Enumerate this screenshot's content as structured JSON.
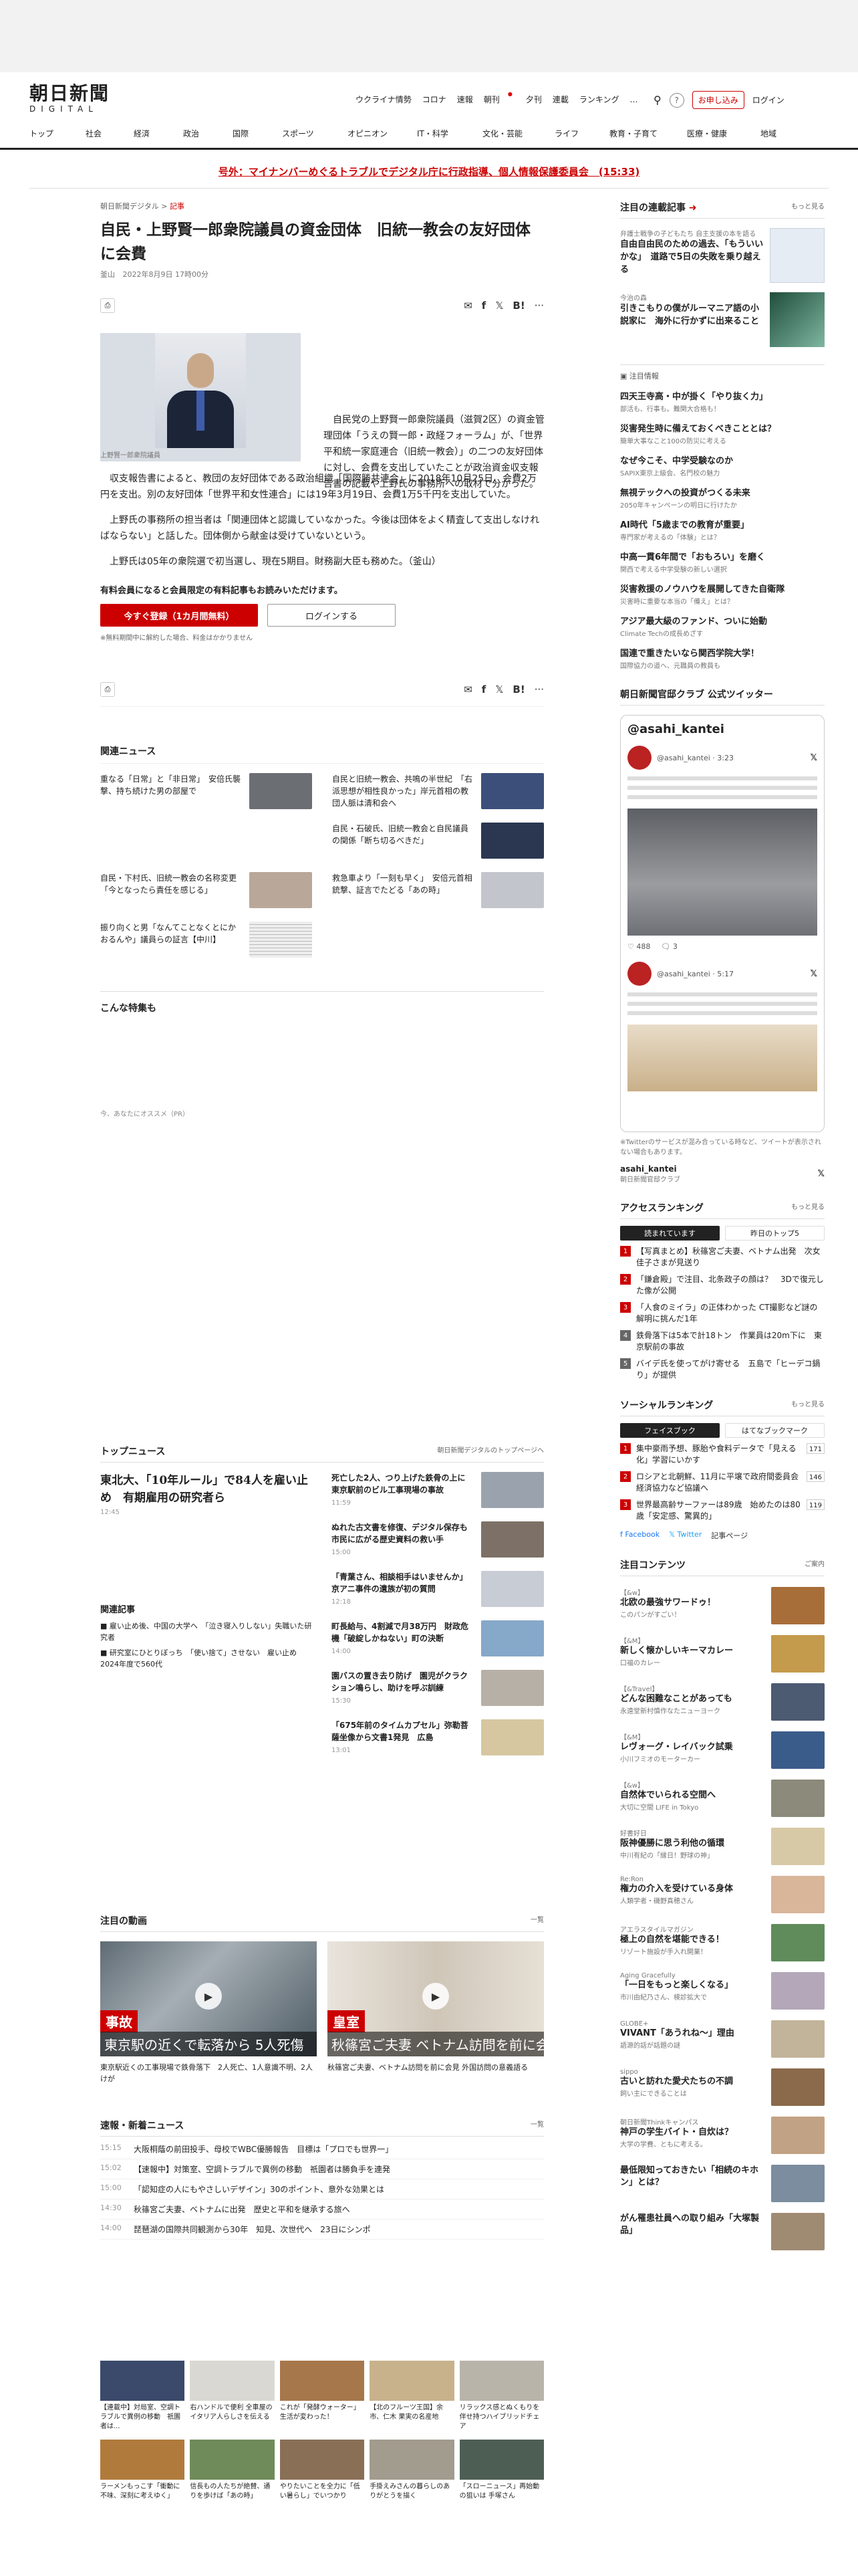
{
  "header": {
    "logo_jp": "朝日新聞",
    "logo_en": "DIGITAL",
    "nav": [
      "ウクライナ情勢",
      "コロナ",
      "速報",
      "朝刊",
      "夕刊",
      "連載",
      "ランキング",
      "…"
    ],
    "subscribe": "お申し込み",
    "login": "ログイン",
    "categories": [
      "トップ",
      "社会",
      "経済",
      "政治",
      "国際",
      "スポーツ",
      "オピニオン",
      "IT・科学",
      "文化・芸能",
      "ライフ",
      "教育・子育て",
      "医療・健康",
      "地域"
    ]
  },
  "alert": "号外：マイナンバーめぐるトラブルでデジタル庁に行政指導、個人情報保護委員会　(15:33)",
  "article": {
    "crumb_site": "朝日新聞デジタル",
    "crumb_sep": ">",
    "crumb_type": "記事",
    "title": "自民・上野賢一郎衆院議員の資金団体　旧統一教会の友好団体に会費",
    "byline": "釜山",
    "date": "2022年8月9日 17時00分",
    "share_count": "1",
    "share_label": "list",
    "photo_caption": "上野賢一郎衆院議員",
    "p1": "自民党の上野賢一郎衆院議員（滋賀2区）の資金管理団体「うえの賢一郎・政経フォーラム」が、「世界平和統一家庭連合（旧統一教会）」の二つの友好団体に対し、会費を支出していたことが政治資金収支報告書の記載や上野氏の事務所への取材で分かった。",
    "p2": "収支報告書によると、教団の友好団体である政治組織「国際勝共連合」に2018年10月25日、会費2万円を支出。別の友好団体「世界平和女性連合」には19年3月19日、会費1万5千円を支出していた。",
    "p3": "上野氏の事務所の担当者は「関連団体と認識していなかった。今後は団体をよく精査して支出しなければならない」と話した。団体側から献金は受けていないという。",
    "p4": "上野氏は05年の衆院選で初当選し、現在5期目。財務副大臣も務めた。（釜山）",
    "member_text": "有料会員になると会員限定の有料記事もお読みいただけます。",
    "register_btn": "今すぐ登録（1カ月間無料）",
    "login_btn": "ログインする",
    "note": "※無料期間中に解約した場合、料金はかかりません"
  },
  "related": {
    "title": "関連ニュース",
    "items": [
      {
        "t": "重なる「日常」と「非日常」　安倍氏襲撃、持ち続けた男の部屋で"
      },
      {
        "t": "自民と旧統一教会、共鳴の半世紀　「右派思想が相性良かった」岸元首相の教団人脈は清和会へ"
      },
      {
        "t": "自民・石破氏、旧統一教会と自民議員の関係「断ち切るべきだ」"
      },
      {
        "t": "自民・下村氏、旧統一教会の名称変更「今となったら責任を感じる」"
      },
      {
        "t": "救急車より「一刻も早く」　安倍元首相銃撃、証言でたどる「あの時」"
      },
      {
        "t": "振り向くと男「なんてことなくとにかおるんや」議員らの証言【中川】"
      }
    ]
  },
  "feature": {
    "title": "こんな特集も",
    "ad_note": "今、あなたにオススメ（PR）"
  },
  "topnews": {
    "title": "トップニュース",
    "more": "朝日新聞デジタルのトップページへ",
    "lead": "東北大、「10年ルール」で84人を雇い止め　有期雇用の研究者ら",
    "lead_time": "12:45",
    "related_title": "関連記事",
    "related": [
      "雇い止め後、中国の大学へ　「泣き寝入りしない」失職いた研究者",
      "研究室にひとりぼっち　「使い捨て」させない　雇い止め2024年度で560代"
    ],
    "items": [
      {
        "t": "死亡した2人、つり上げた鉄骨の上に　東京駅前のビル工事現場の事故",
        "time": "11:59"
      },
      {
        "t": "ぬれた古文書を修復、デジタル保存も　市民に広がる歴史資料の救い手",
        "time": "15:00"
      },
      {
        "t": "「青葉さん、相談相手はいませんか」京アニ事件の遺族が初の質問",
        "time": "12:18"
      },
      {
        "t": "町長給与、4割減で月38万円　財政危機「破綻しかねない」町の決断",
        "time": "14:00"
      },
      {
        "t": "園バスの置き去り防げ　園児がクラクション鳴らし、助けを呼ぶ訓練",
        "time": "15:30"
      },
      {
        "t": "「675年前のタイムカプセル」弥勒菩薩坐像から文書1発見　広島",
        "time": "13:01"
      }
    ]
  },
  "videos": {
    "title": "注目の動画",
    "more": "一覧",
    "items": [
      {
        "label": "事故",
        "cap": "東京駅の近くで転落から 5人死傷",
        "t": "東京駅近くの工事現場で鉄骨落下　2人死亡、1人意識不明、2人けが"
      },
      {
        "label": "皇室",
        "cap": "秋篠宮ご夫妻 ベトナム訪問を前に会見",
        "t": "秋篠宮ご夫妻、ベトナム訪問を前に会見 外国訪問の意義語る"
      }
    ]
  },
  "flash": {
    "title": "速報・新着ニュース",
    "more": "一覧",
    "items": [
      {
        "time": "15:15",
        "t": "大阪桐蔭の前田投手、母校でWBC優勝報告　目標は「プロでも世界一」"
      },
      {
        "time": "15:02",
        "t": "【速報中】対策室、空調トラブルで異例の移動　祇園者は勝負手を連発"
      },
      {
        "time": "15:00",
        "t": "「認知症の人にもやさしいデザイン」30のポイント、意外な効果とは"
      },
      {
        "time": "14:30",
        "t": "秋篠宮ご夫妻、ベトナムに出発　歴史と平和を継承する旅へ"
      },
      {
        "time": "14:00",
        "t": "琵琶湖の国際共同観測から30年　知見、次世代へ　23日にシンポ"
      }
    ]
  },
  "bottom_ads": [
    {
      "t": "【連載中】対局室、空調トラブルで異例の移動　祇園者は..."
    },
    {
      "t": "右ハンドルで便利 全車屋のイタリア人らしさを伝える"
    },
    {
      "t": "これが「発酵ウォーター」生活が変わった！"
    },
    {
      "t": "【北のフルーツ王国】余市、仁木 果実の名産地"
    },
    {
      "t": "リラックス感とぬくもりを伴せ持つハイブリッドチェア"
    },
    {
      "t": "ラーメンもっこす「衝動に不味、深刻に考えゆく」"
    },
    {
      "t": "信長もの人たちが絶賛、通りを歩けば「あの時」"
    },
    {
      "t": "やりたいことを全力に「低い暑らし」でいつかり"
    },
    {
      "t": "手掛えみさんの暮らしのありがとうを描く"
    },
    {
      "t": "「スローニュース」再始動の狙いは 手塚さん"
    }
  ],
  "side": {
    "series_title": "注目の連載記事",
    "more": "もっと見る",
    "series": [
      {
        "k": "弁護士戦争の子どもたち 自主支援の本を語る",
        "h": "自由自由民のための過去、「もういいかな」　道路で5日の失敗を乗り越える"
      },
      {
        "k": "今治の森",
        "h": "引きこもりの僕がルーマニア語の小説家に　海外に行かずに出来ること"
      }
    ],
    "info_title": "注目情報",
    "info": [
      {
        "h": "四天王寺高・中が掛く「やり抜く力」",
        "d": "部活も、行事も。難関大合格も！"
      },
      {
        "h": "災害発生時に備えておくべきこととは？",
        "d": "簡単大事なこと100の防災に考える"
      },
      {
        "h": "なぜ今こそ、中学受験なのか",
        "d": "SAPIX東京上級会、名門校の魅力"
      },
      {
        "h": "無視テックへの投資がつくる未来",
        "d": "2050年キャンペーンの明日に行けたか"
      },
      {
        "h": "AI時代「5歳までの教育が重要」",
        "d": "専門家が考えるの「体験」とは？"
      },
      {
        "h": "中高一貫6年間で「おもろい」を磨く",
        "d": "関西で考える中学受験の新しい選択"
      },
      {
        "h": "災害救援のノウハウを展開してきた自衛隊",
        "d": "災害時に重要な本当の「備え」とは？"
      },
      {
        "h": "アジア最大級のファンド、ついに始動",
        "d": "Climate Techの成長めざす"
      },
      {
        "h": "国連で重きたいなら関西学院大学！",
        "d": "国際協力の道へ、元職員の教員も"
      }
    ],
    "twitter_title": "朝日新聞官邸クラブ 公式ツイッター",
    "twitter_handle": "@asahi_kantei",
    "twitter_name": "朝日新聞官邸クラブ",
    "tweet1_time": "3:23",
    "tweet2_time": "5:17",
    "tweet_likes": "488",
    "tweet_replies": "3",
    "twitter_note": "※Twitterのサービスが混み合っている時など、ツイートが表示されない場合もあります。",
    "twitter_footer": "asahi_kantei",
    "twitter_footer_sub": "朝日新聞官邸クラブ",
    "access_title": "アクセスランキング",
    "access_tabs": [
      "読まれています",
      "昨日のトップ5"
    ],
    "access": [
      "【写真まとめ】秋篠宮ご夫妻、ベトナム出発　次女佳子さまが見送り",
      "「鎌倉殿」で注目、北条政子の顔は？　3Dで復元した像が公開",
      "「人食のミイラ」の正体わかった CT撮影など謎の解明に挑んだ1年",
      "鉄骨落下は5本で計18トン　作業員は20m下に　東京駅前の事故",
      "バイデ氏を使ってがけ寄せる　五島で「ヒーデコ鍋り」が提供"
    ],
    "social_title": "ソーシャルランキング",
    "social_tabs": [
      "フェイスブック",
      "はてなブックマーク"
    ],
    "social": [
      {
        "t": "集中豪雨予想、豚胎や食料データで「見える化」学習にいかす",
        "n": "171"
      },
      {
        "t": "ロシアと北朝鮮、11月に平壌で政府間委員会　経済協力など協議へ",
        "n": "146"
      },
      {
        "t": "世界最高齢サーファーは89歳　始めたのは80歳「安定感、驚異的」",
        "n": "119"
      }
    ],
    "follow": [
      "Facebook",
      "Twitter",
      "記事ページ"
    ],
    "content_title": "注目コンテンツ",
    "content_more": "ご案内",
    "contents": [
      {
        "k": "【&w】",
        "h": "北欧の最強サワードゥ！",
        "d": "このパンがすごい！"
      },
      {
        "k": "【&M】",
        "h": "新しく懐かしいキーマカレー",
        "d": "口福のカレー"
      },
      {
        "k": "【&Travel】",
        "h": "どんな困難なことがあっても",
        "d": "永遠堂新村慎作なたニューヨーク"
      },
      {
        "k": "【&M】",
        "h": "レヴォーグ・レイバック試乗",
        "d": "小川フミオのモーターカー"
      },
      {
        "k": "【&w】",
        "h": "自然体でいられる空間へ",
        "d": "大切に空間 LIFE in Tokyo"
      },
      {
        "k": "好書好日",
        "h": "阪神優勝に思う利他の循環",
        "d": "中川有紀の「縁日！野球の神」"
      },
      {
        "k": "Re:Ron",
        "h": "権力の介入を受けている身体",
        "d": "人類学者・磯野真穂さん"
      },
      {
        "k": "アエラスタイルマガジン",
        "h": "極上の自然を堪能できる！",
        "d": "リゾート施設が手入れ開業！"
      },
      {
        "k": "Aging Gracefully",
        "h": "「一日をもっと楽しくなる」",
        "d": "市川由紀乃さん、検診拡大で"
      },
      {
        "k": "GLOBE+",
        "h": "VIVANT「あうれね〜」理由",
        "d": "語源的話が話題の謎"
      },
      {
        "k": "sippo",
        "h": "古いと訪れた愛犬たちの不調",
        "d": "飼い主にできることは"
      },
      {
        "k": "朝日新聞Thinkキャンパス",
        "h": "神戸の学生バイト・自炊は？",
        "d": "大学の学費、ともに考える。"
      },
      {
        "k": "",
        "h": "最低限知っておきたい「相続のキホン」とは？",
        "d": ""
      },
      {
        "k": "",
        "h": "がん罹患社員への取り組み「大塚製品」",
        "d": ""
      }
    ]
  }
}
